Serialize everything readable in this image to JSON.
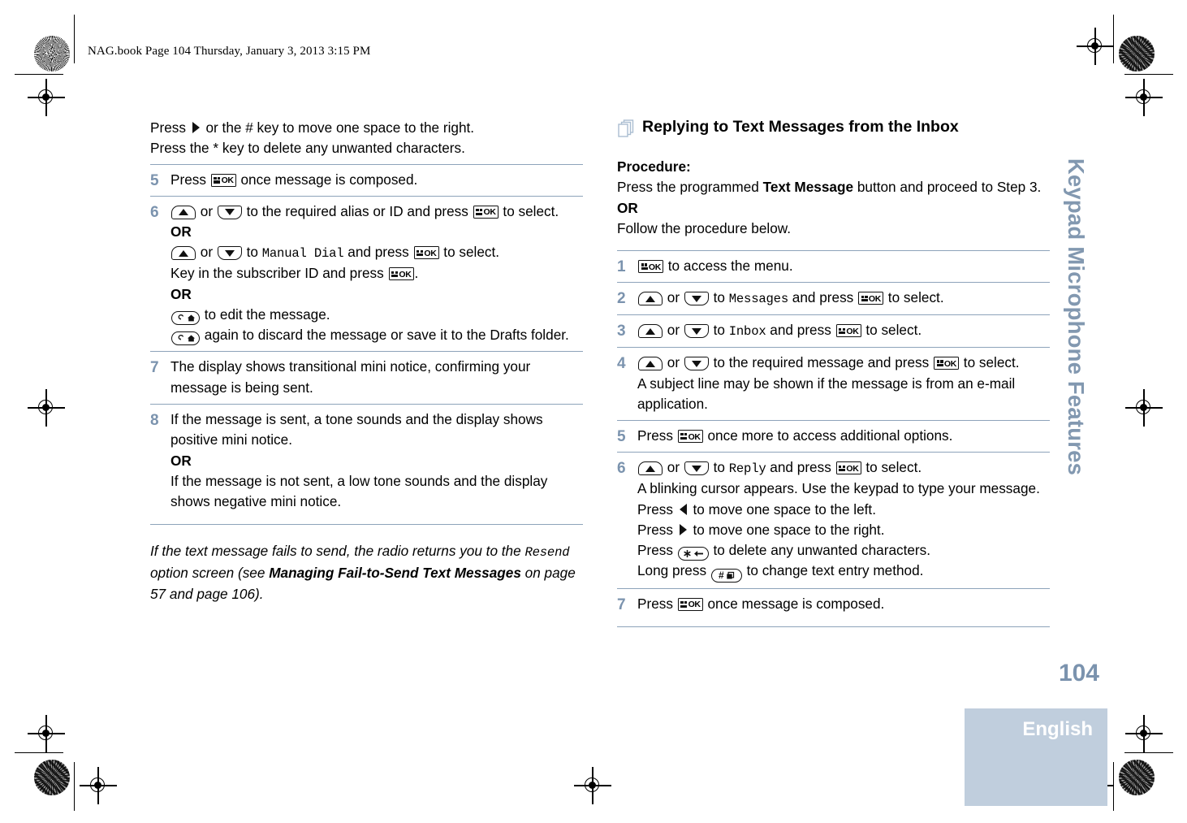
{
  "file_header": "NAG.book  Page 104  Thursday, January 3, 2013  3:15 PM",
  "sidebar": {
    "tab_label": "Keypad Microphone Features",
    "page_number": "104",
    "language": "English",
    "accent_color": "#8298b0",
    "language_bar_color": "#c0cedd"
  },
  "icons": {
    "ok_key": "ok-key-icon",
    "up_key": "up-arrow-key-icon",
    "down_key": "down-arrow-key-icon",
    "back_home_key": "back-home-key-icon",
    "star_delete_key": "star-delete-key-icon",
    "hash_key": "hash-key-icon",
    "right_arrow": "right-arrow-icon",
    "left_arrow": "left-arrow-icon",
    "pages": "stacked-pages-icon"
  },
  "left_column": {
    "intro": [
      {
        "pre": "Press ",
        "icon": "right_arrow",
        "post": " or the # key to move one space to the right."
      },
      {
        "pre": "Press the * key to delete any unwanted characters.",
        "icon": null,
        "post": ""
      }
    ],
    "steps": [
      {
        "number": "5",
        "lines": [
          {
            "segments": [
              {
                "t": "text",
                "v": "Press "
              },
              {
                "t": "icon",
                "v": "ok_key"
              },
              {
                "t": "text",
                "v": " once message is composed."
              }
            ]
          }
        ]
      },
      {
        "number": "6",
        "lines": [
          {
            "segments": [
              {
                "t": "icon",
                "v": "up_key"
              },
              {
                "t": "text",
                "v": " or "
              },
              {
                "t": "icon",
                "v": "down_key"
              },
              {
                "t": "text",
                "v": " to the required alias or ID and press "
              },
              {
                "t": "icon",
                "v": "ok_key"
              },
              {
                "t": "text",
                "v": " to select."
              }
            ]
          },
          {
            "segments": [
              {
                "t": "bold",
                "v": "OR"
              }
            ]
          },
          {
            "segments": [
              {
                "t": "icon",
                "v": "up_key"
              },
              {
                "t": "text",
                "v": " or "
              },
              {
                "t": "icon",
                "v": "down_key"
              },
              {
                "t": "text",
                "v": " to "
              },
              {
                "t": "mono",
                "v": "Manual Dial"
              },
              {
                "t": "text",
                "v": " and press "
              },
              {
                "t": "icon",
                "v": "ok_key"
              },
              {
                "t": "text",
                "v": " to select."
              }
            ]
          },
          {
            "segments": [
              {
                "t": "text",
                "v": "Key in the subscriber ID and press "
              },
              {
                "t": "icon",
                "v": "ok_key"
              },
              {
                "t": "text",
                "v": "."
              }
            ]
          },
          {
            "segments": [
              {
                "t": "bold",
                "v": "OR"
              }
            ]
          },
          {
            "segments": [
              {
                "t": "icon",
                "v": "back_home_key"
              },
              {
                "t": "text",
                "v": " to edit the message."
              }
            ]
          },
          {
            "segments": [
              {
                "t": "icon",
                "v": "back_home_key"
              },
              {
                "t": "text",
                "v": " again to discard the message or save it to the Drafts folder."
              }
            ]
          }
        ]
      },
      {
        "number": "7",
        "lines": [
          {
            "segments": [
              {
                "t": "text",
                "v": "The display shows transitional mini notice, confirming your message is being sent."
              }
            ]
          }
        ]
      },
      {
        "number": "8",
        "lines": [
          {
            "segments": [
              {
                "t": "text",
                "v": "If the message is sent, a tone sounds and the display shows positive mini notice."
              }
            ]
          },
          {
            "segments": [
              {
                "t": "bold",
                "v": "OR"
              }
            ]
          },
          {
            "segments": [
              {
                "t": "text",
                "v": "If the message is not sent, a low tone sounds and the display shows negative mini notice."
              }
            ]
          }
        ]
      }
    ],
    "note": {
      "part1": "If the text message fails to send, the radio returns you to the ",
      "mono": "Resend",
      "part2": " option screen (see ",
      "bold": "Managing Fail-to-Send Text Messages",
      "part3": " on page 57 and page 106)."
    }
  },
  "right_column": {
    "heading": "Replying to Text Messages from the Inbox",
    "procedure_label": "Procedure:",
    "intro": [
      {
        "segments": [
          {
            "t": "text",
            "v": "Press the programmed "
          },
          {
            "t": "bold",
            "v": "Text Message"
          },
          {
            "t": "text",
            "v": " button and proceed to Step 3."
          }
        ]
      },
      {
        "segments": [
          {
            "t": "bold",
            "v": "OR"
          }
        ]
      },
      {
        "segments": [
          {
            "t": "text",
            "v": "Follow the procedure below."
          }
        ]
      }
    ],
    "steps": [
      {
        "number": "1",
        "lines": [
          {
            "segments": [
              {
                "t": "icon",
                "v": "ok_key"
              },
              {
                "t": "text",
                "v": " to access the menu."
              }
            ]
          }
        ]
      },
      {
        "number": "2",
        "lines": [
          {
            "segments": [
              {
                "t": "icon",
                "v": "up_key"
              },
              {
                "t": "text",
                "v": " or "
              },
              {
                "t": "icon",
                "v": "down_key"
              },
              {
                "t": "text",
                "v": " to "
              },
              {
                "t": "mono",
                "v": "Messages"
              },
              {
                "t": "text",
                "v": " and press "
              },
              {
                "t": "icon",
                "v": "ok_key"
              },
              {
                "t": "text",
                "v": " to select."
              }
            ]
          }
        ]
      },
      {
        "number": "3",
        "lines": [
          {
            "segments": [
              {
                "t": "icon",
                "v": "up_key"
              },
              {
                "t": "text",
                "v": " or "
              },
              {
                "t": "icon",
                "v": "down_key"
              },
              {
                "t": "text",
                "v": " to "
              },
              {
                "t": "mono",
                "v": "Inbox"
              },
              {
                "t": "text",
                "v": " and press "
              },
              {
                "t": "icon",
                "v": "ok_key"
              },
              {
                "t": "text",
                "v": " to select."
              }
            ]
          }
        ]
      },
      {
        "number": "4",
        "lines": [
          {
            "segments": [
              {
                "t": "icon",
                "v": "up_key"
              },
              {
                "t": "text",
                "v": " or "
              },
              {
                "t": "icon",
                "v": "down_key"
              },
              {
                "t": "text",
                "v": " to the required message and press "
              },
              {
                "t": "icon",
                "v": "ok_key"
              },
              {
                "t": "text",
                "v": " to select."
              }
            ]
          },
          {
            "segments": [
              {
                "t": "text",
                "v": "A subject line may be shown if the message is from an e-mail application."
              }
            ]
          }
        ]
      },
      {
        "number": "5",
        "lines": [
          {
            "segments": [
              {
                "t": "text",
                "v": "Press "
              },
              {
                "t": "icon",
                "v": "ok_key"
              },
              {
                "t": "text",
                "v": " once more to access additional options."
              }
            ]
          }
        ]
      },
      {
        "number": "6",
        "lines": [
          {
            "segments": [
              {
                "t": "icon",
                "v": "up_key"
              },
              {
                "t": "text",
                "v": " or "
              },
              {
                "t": "icon",
                "v": "down_key"
              },
              {
                "t": "text",
                "v": " to "
              },
              {
                "t": "mono",
                "v": "Reply"
              },
              {
                "t": "text",
                "v": " and press "
              },
              {
                "t": "icon",
                "v": "ok_key"
              },
              {
                "t": "text",
                "v": " to select."
              }
            ]
          },
          {
            "segments": [
              {
                "t": "text",
                "v": "A blinking cursor appears. Use the keypad to type your message."
              }
            ]
          },
          {
            "segments": [
              {
                "t": "text",
                "v": "Press "
              },
              {
                "t": "icon",
                "v": "left_arrow"
              },
              {
                "t": "text",
                "v": " to move one space to the left."
              }
            ]
          },
          {
            "segments": [
              {
                "t": "text",
                "v": "Press "
              },
              {
                "t": "icon",
                "v": "right_arrow"
              },
              {
                "t": "text",
                "v": " to move one space to the right."
              }
            ]
          },
          {
            "segments": [
              {
                "t": "text",
                "v": "Press "
              },
              {
                "t": "icon",
                "v": "star_delete_key"
              },
              {
                "t": "text",
                "v": " to delete any unwanted characters."
              }
            ]
          },
          {
            "segments": [
              {
                "t": "text",
                "v": "Long press "
              },
              {
                "t": "icon",
                "v": "hash_key"
              },
              {
                "t": "text",
                "v": " to change text entry method."
              }
            ]
          }
        ]
      },
      {
        "number": "7",
        "lines": [
          {
            "segments": [
              {
                "t": "text",
                "v": "Press "
              },
              {
                "t": "icon",
                "v": "ok_key"
              },
              {
                "t": "text",
                "v": " once message is composed."
              }
            ]
          }
        ]
      }
    ]
  }
}
